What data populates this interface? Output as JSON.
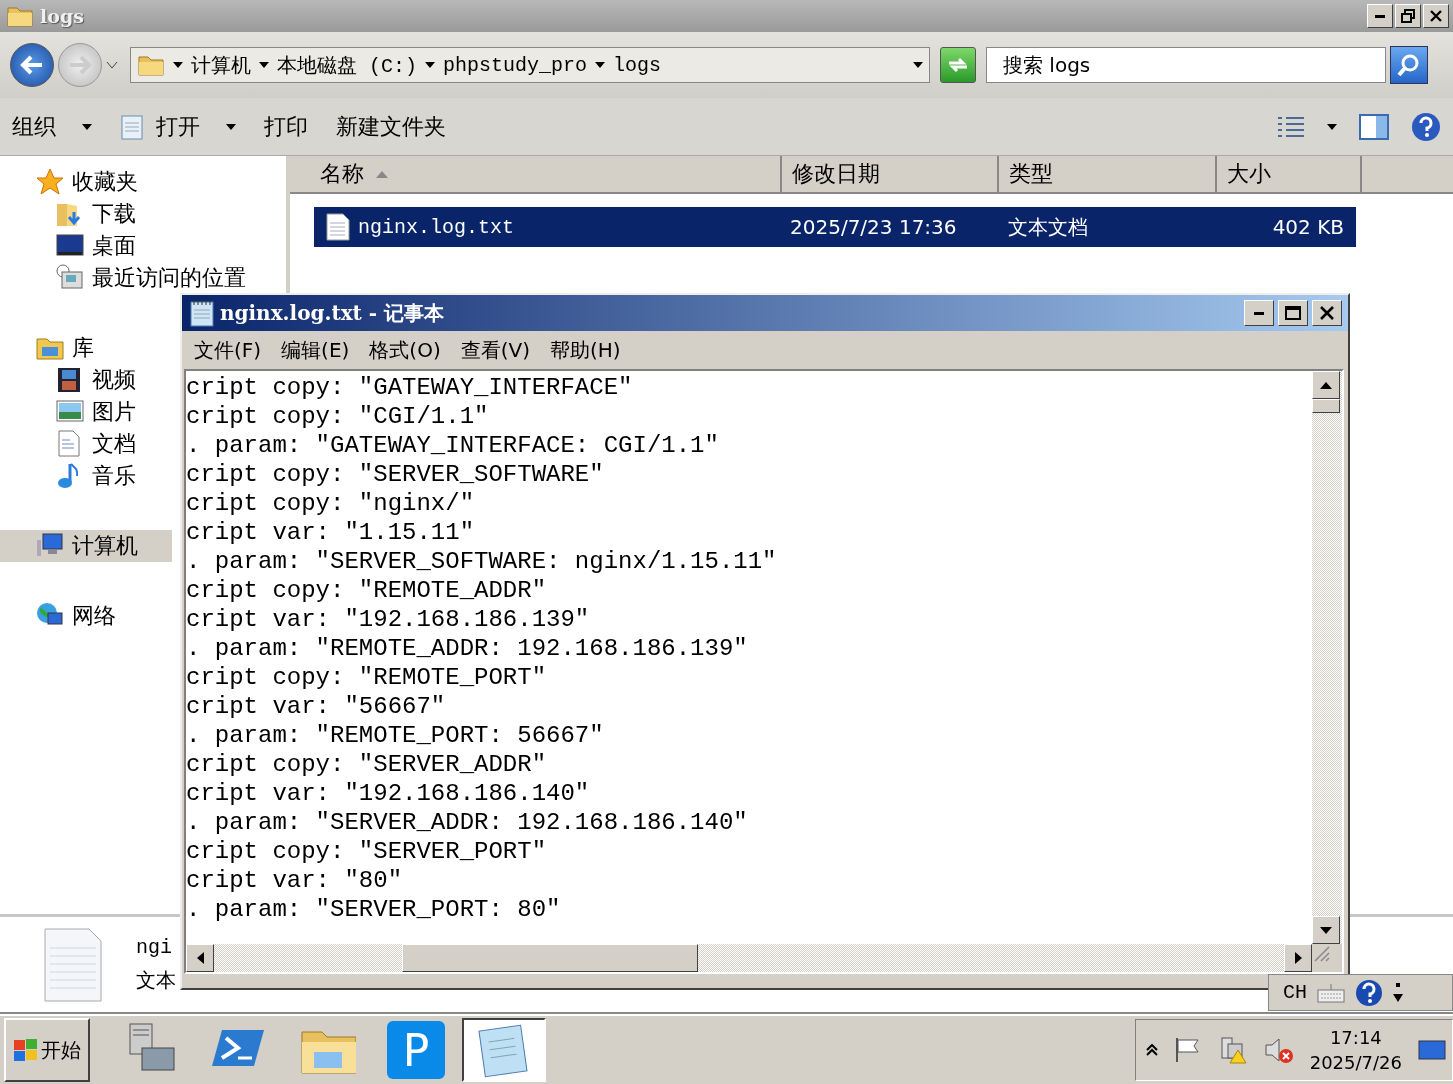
{
  "explorer": {
    "title": "logs",
    "breadcrumb": [
      "计算机",
      "本地磁盘 (C:)",
      "phpstudy_pro",
      "logs"
    ],
    "search": {
      "placeholder": "搜索 logs"
    },
    "toolbar": [
      {
        "label": "组织",
        "dropdown": true
      },
      {
        "label": "打开",
        "dropdown": true
      },
      {
        "label": "打印",
        "dropdown": false
      },
      {
        "label": "新建文件夹",
        "dropdown": false
      }
    ],
    "nav": [
      {
        "label": "收藏夹",
        "selected": false,
        "children": [
          {
            "label": "下载",
            "selected": false
          },
          {
            "label": "桌面",
            "selected": false
          },
          {
            "label": "最近访问的位置",
            "selected": false
          }
        ]
      },
      {
        "label": "库",
        "selected": false,
        "children": [
          {
            "label": "视频",
            "selected": false
          },
          {
            "label": "图片",
            "selected": false
          },
          {
            "label": "文档",
            "selected": false
          },
          {
            "label": "音乐",
            "selected": false
          }
        ]
      },
      {
        "label": "计算机",
        "selected": true
      },
      {
        "label": "网络",
        "selected": false
      }
    ],
    "columns": [
      {
        "label": "名称",
        "sorted": true
      },
      {
        "label": "修改日期",
        "sorted": false
      },
      {
        "label": "类型",
        "sorted": false
      },
      {
        "label": "大小",
        "sorted": false
      }
    ],
    "files": [
      {
        "name": "nginx.log.txt",
        "modified": "2025/7/23 17:36",
        "type": "文本文档",
        "size": "402 KB",
        "selected": true
      }
    ],
    "details": {
      "name": "ngi",
      "type": "文本"
    }
  },
  "notepad": {
    "title": "nginx.log.txt - 记事本",
    "menu": [
      "文件(F)",
      "编辑(E)",
      "格式(O)",
      "查看(V)",
      "帮助(H)"
    ],
    "lines": [
      "cript copy: \"GATEWAY_INTERFACE\"",
      "cript copy: \"CGI/1.1\"",
      ". param: \"GATEWAY_INTERFACE: CGI/1.1\"",
      "cript copy: \"SERVER_SOFTWARE\"",
      "cript copy: \"nginx/\"",
      "cript var: \"1.15.11\"",
      ". param: \"SERVER_SOFTWARE: nginx/1.15.11\"",
      "cript copy: \"REMOTE_ADDR\"",
      "cript var: \"192.168.186.139\"",
      ". param: \"REMOTE_ADDR: 192.168.186.139\"",
      "cript copy: \"REMOTE_PORT\"",
      "cript var: \"56667\"",
      ". param: \"REMOTE_PORT: 56667\"",
      "cript copy: \"SERVER_ADDR\"",
      "cript var: \"192.168.186.140\"",
      ". param: \"SERVER_ADDR: 192.168.186.140\"",
      "cript copy: \"SERVER_PORT\"",
      "cript var: \"80\"",
      ". param: \"SERVER_PORT: 80\""
    ]
  },
  "language_bar": {
    "label": "CH"
  },
  "taskbar": {
    "start": "开始",
    "apps": [
      {
        "selected": false
      },
      {
        "selected": false
      },
      {
        "selected": false
      },
      {
        "label": "P",
        "selected": false
      },
      {
        "selected": true
      }
    ],
    "clock": {
      "time": "17:14",
      "date": "2025/7/26"
    }
  }
}
